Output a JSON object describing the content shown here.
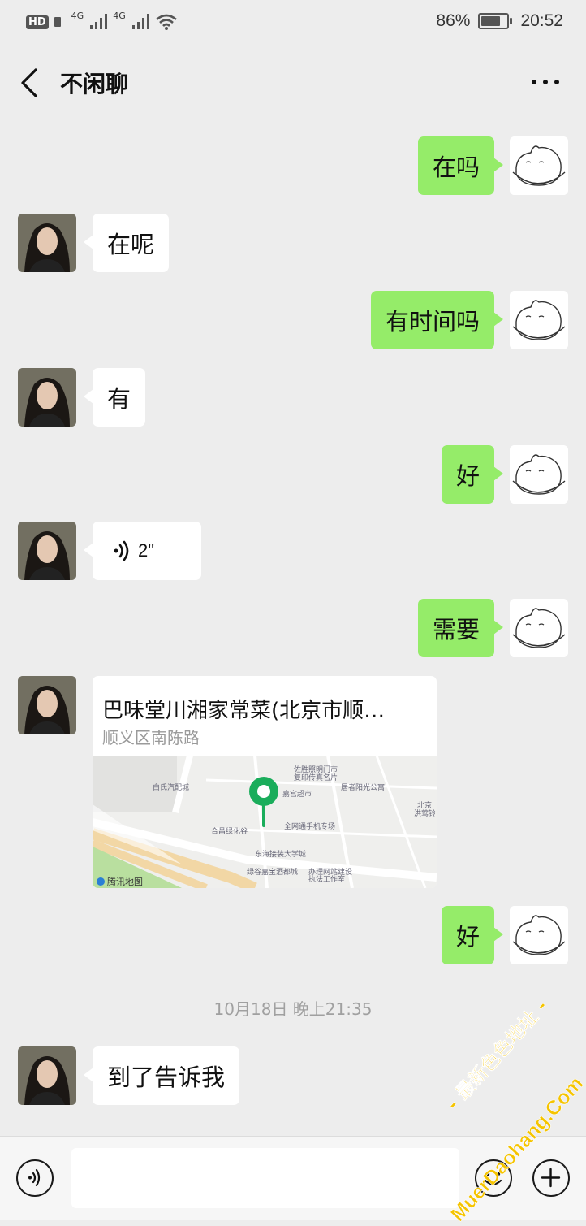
{
  "status_bar": {
    "network_left": "HD",
    "signal_1": "4G",
    "signal_2": "4G",
    "battery_percent": "86%",
    "battery_level": 0.86,
    "time": "20:52"
  },
  "header": {
    "title": "不闲聊",
    "back_icon": "chevron-left-icon",
    "more_icon": "more-dots-icon"
  },
  "messages": [
    {
      "side": "right",
      "text": "在吗"
    },
    {
      "side": "left",
      "text": "在呢"
    },
    {
      "side": "right",
      "text": "有时间吗"
    },
    {
      "side": "left",
      "text": "有"
    },
    {
      "side": "right",
      "text": "好"
    },
    {
      "side": "left",
      "type": "voice",
      "text": "2\""
    },
    {
      "side": "right",
      "text": "需要"
    },
    {
      "side": "left",
      "type": "location",
      "title": "巴味堂川湘家常菜(北京市顺…",
      "subtitle": "顺义区南陈路",
      "map_brand": "腾讯地图",
      "map_labels": [
        "佐胜照明门市",
        "复印传真名片",
        "嘉宫超市",
        "居者阳光公寓",
        "北京",
        "洪莺铃",
        "白氏汽配城",
        "合昌绿化谷",
        "全网通手机专场",
        "东海接装大学城",
        "绿谷嘉宝酒都城",
        "办理网站建设",
        "执法工作室"
      ]
    },
    {
      "side": "right",
      "text": "好"
    },
    {
      "type": "timestamp",
      "text": "10月18日 晚上21:35"
    },
    {
      "side": "left",
      "text": "到了告诉我"
    }
  ],
  "input_bar": {
    "voice_icon": "voice-toggle-icon",
    "emoji_icon": "emoji-icon",
    "plus_icon": "plus-icon"
  },
  "watermark": {
    "line1": "- 最新色色地址 -",
    "line2": "MuerDaohang.Com"
  },
  "colors": {
    "background": "#ededed",
    "bubble_self": "#95ec69",
    "bubble_other": "#ffffff",
    "map_pin": "#1aad5b",
    "watermark": "#f5c400"
  }
}
